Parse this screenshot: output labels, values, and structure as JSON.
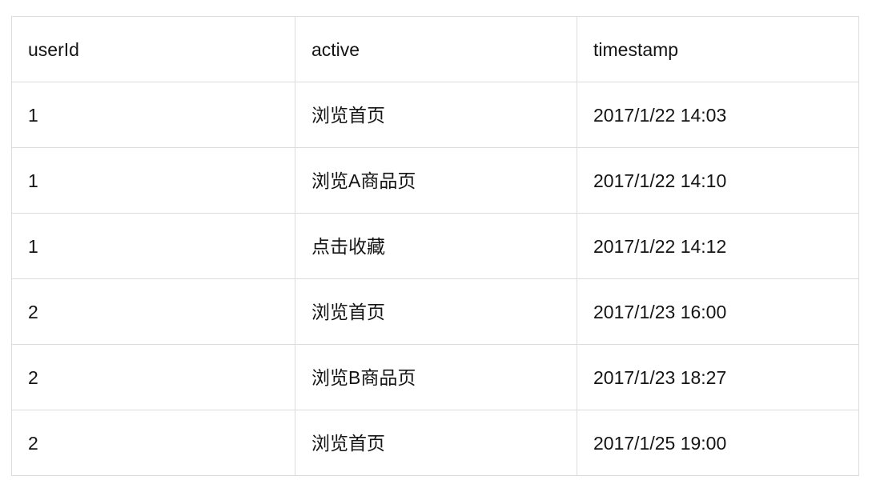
{
  "table": {
    "columns": [
      {
        "key": "userId",
        "label": "userId"
      },
      {
        "key": "active",
        "label": "active"
      },
      {
        "key": "timestamp",
        "label": "timestamp"
      }
    ],
    "rows": [
      {
        "userId": "1",
        "active": "浏览首页",
        "timestamp": "2017/1/22 14:03"
      },
      {
        "userId": "1",
        "active": "浏览A商品页",
        "timestamp": "2017/1/22 14:10"
      },
      {
        "userId": "1",
        "active": "点击收藏",
        "timestamp": "2017/1/22 14:12"
      },
      {
        "userId": "2",
        "active": "浏览首页",
        "timestamp": "2017/1/23 16:00"
      },
      {
        "userId": "2",
        "active": "浏览B商品页",
        "timestamp": "2017/1/23 18:27"
      },
      {
        "userId": "2",
        "active": "浏览首页",
        "timestamp": "2017/1/25 19:00"
      }
    ]
  },
  "colors": {
    "border": "#dcdcdc",
    "text": "#141414",
    "background": "#ffffff"
  }
}
